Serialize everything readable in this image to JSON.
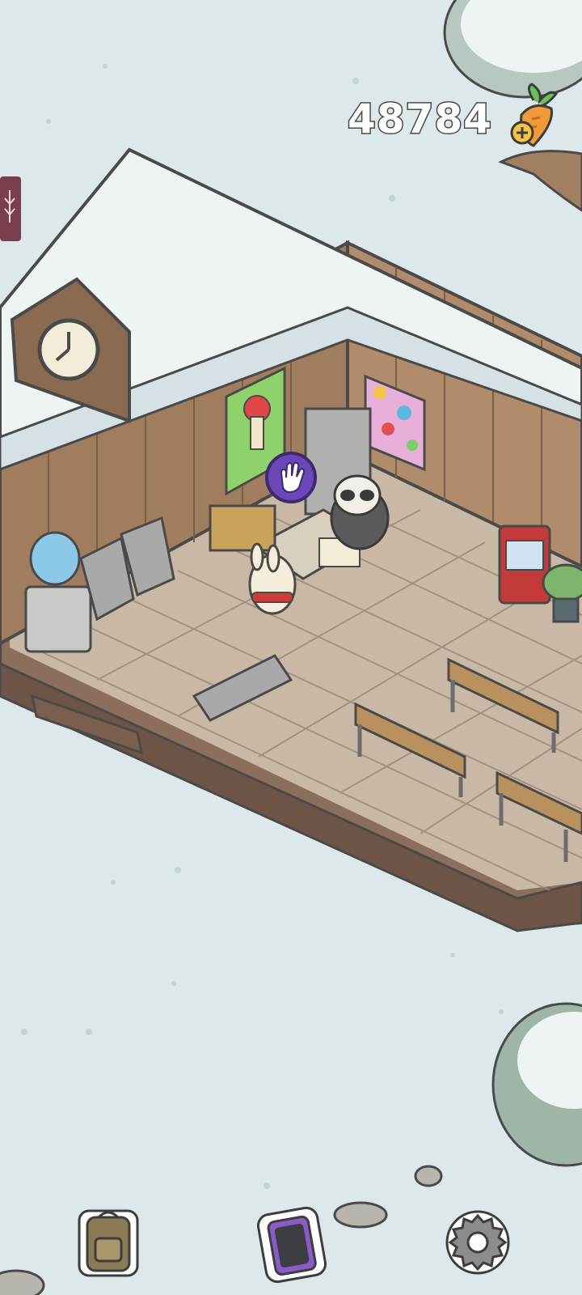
{
  "hud": {
    "carrot_count": "48784",
    "currency_icon": "carrot-icon",
    "add_icon": "plus-icon"
  },
  "scene": {
    "location": "winter-house-interior",
    "interact_icon": "hand-icon"
  },
  "bottom_bar": {
    "items": [
      {
        "icon": "backpack-icon"
      },
      {
        "icon": "phone-icon"
      },
      {
        "icon": "gear-icon"
      }
    ]
  },
  "colors": {
    "snow_ground": "#dde8ea",
    "wall_wood": "#a07d5e",
    "roof_snow": "#eef3f4",
    "floor_tile": "#c9b8a6",
    "interact_purple": "#6b47b8"
  }
}
